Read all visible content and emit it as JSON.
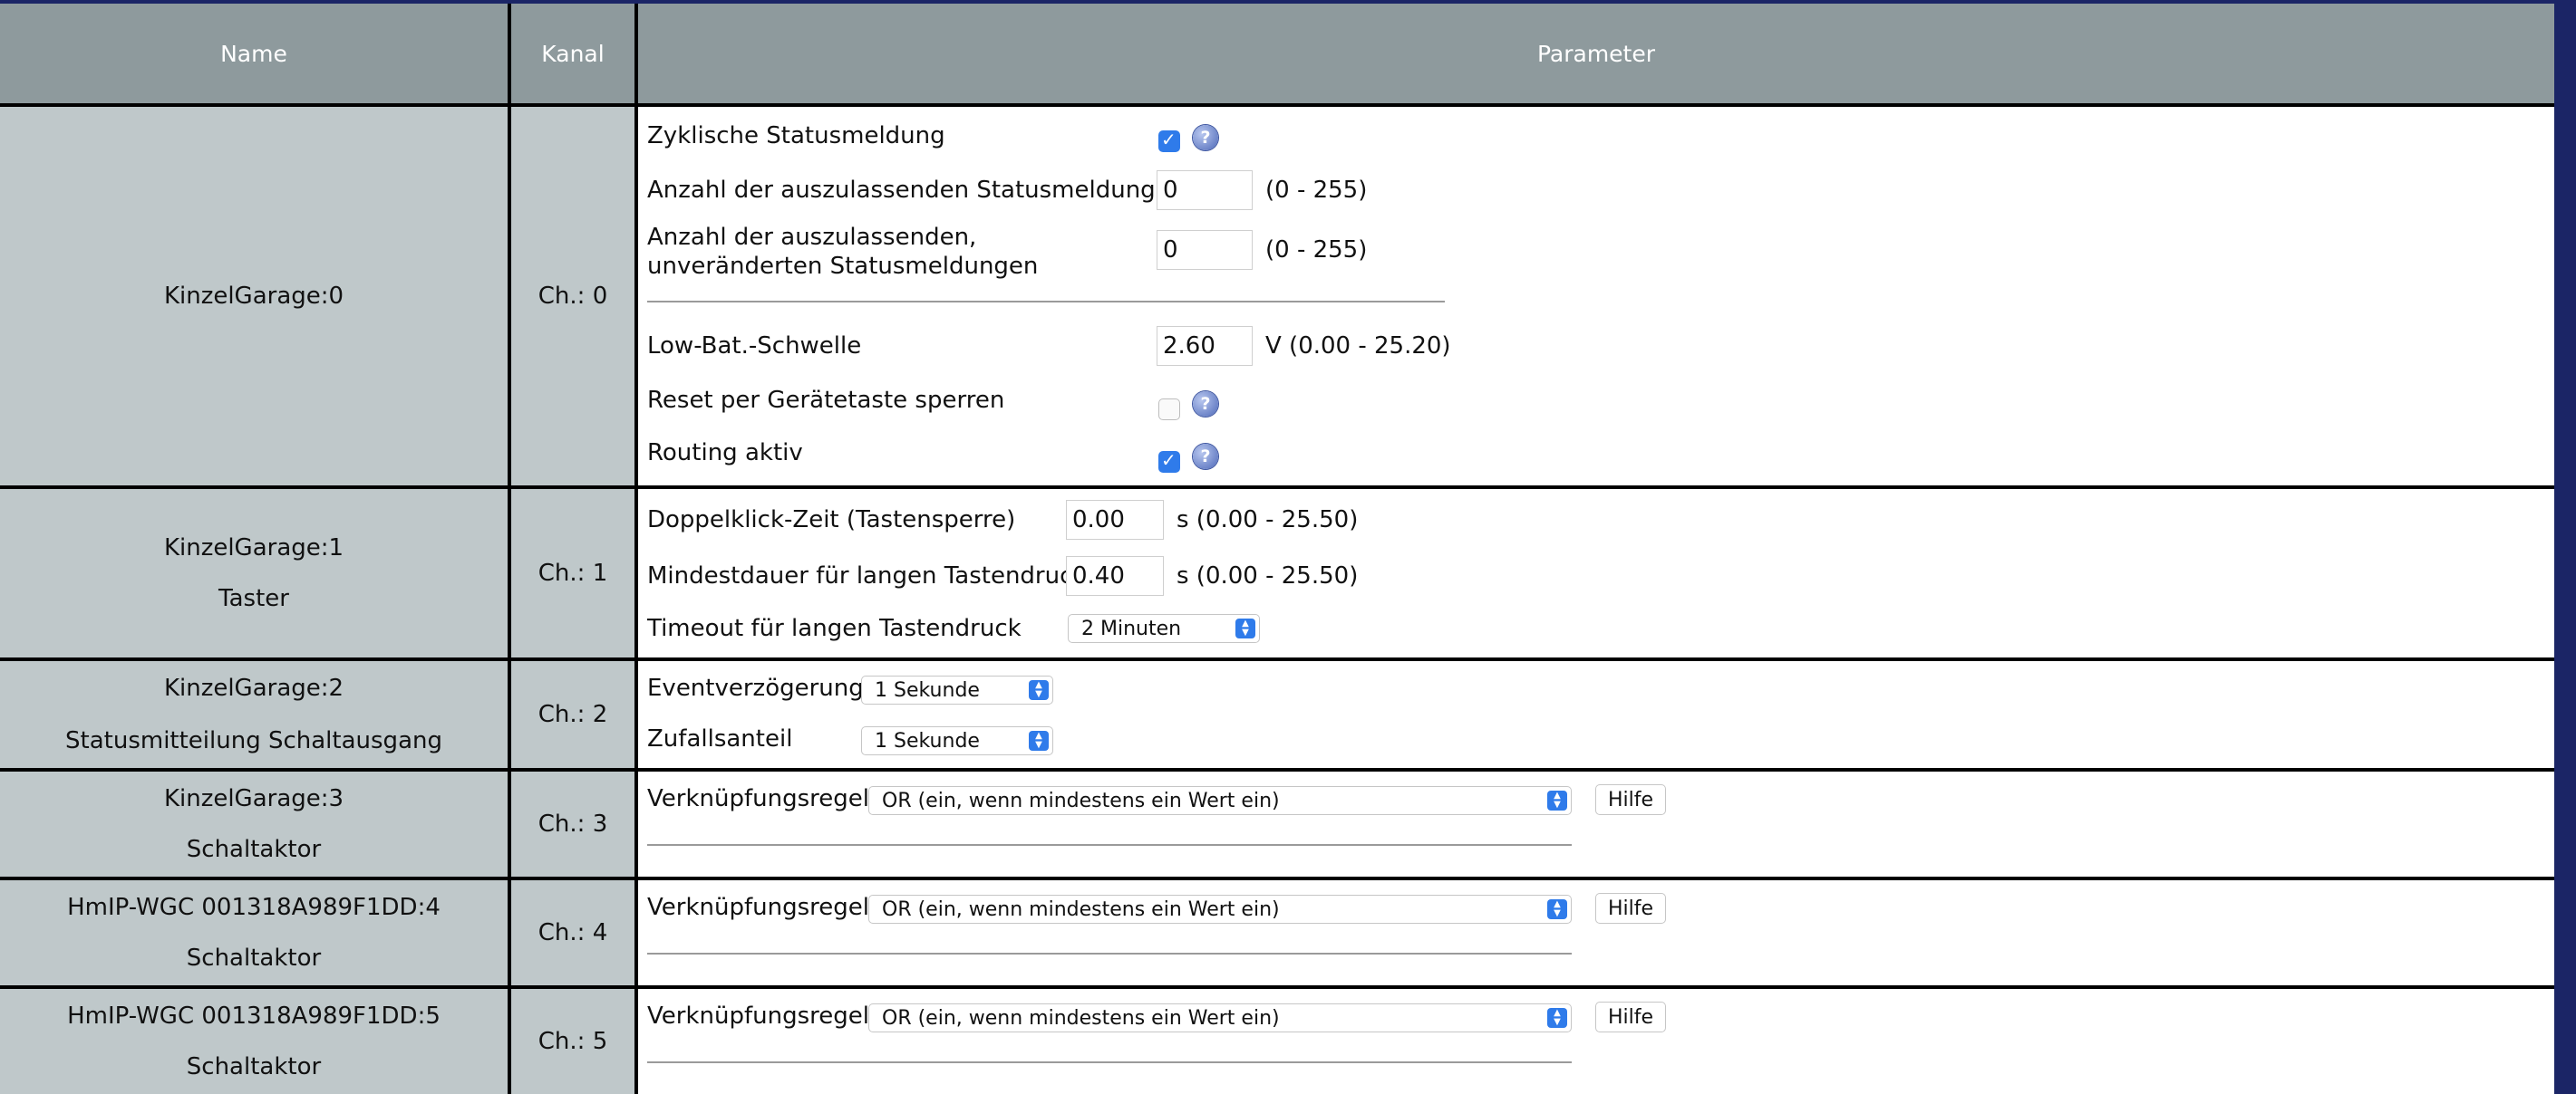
{
  "header": {
    "name": "Name",
    "channel": "Kanal",
    "parameter": "Parameter"
  },
  "rows": [
    {
      "name": "KinzelGarage:0",
      "type": "",
      "channel": "Ch.: 0",
      "params": {
        "cyclic_status": "Zyklische Statusmeldung",
        "skip_status": "Anzahl der auszulassenden Statusmeldungen",
        "skip_status_value": "0",
        "skip_status_range": "(0 - 255)",
        "skip_unchanged": "Anzahl der auszulassenden, unveränderten Statusmeldungen",
        "skip_unchanged_value": "0",
        "skip_unchanged_range": "(0 - 255)",
        "lowbat": "Low-Bat.-Schwelle",
        "lowbat_value": "2.60",
        "lowbat_range": "V (0.00 - 25.20)",
        "reset_lock": "Reset per Gerätetaste sperren",
        "routing": "Routing aktiv"
      }
    },
    {
      "name": "KinzelGarage:1",
      "type": "Taster",
      "channel": "Ch.: 1",
      "params": {
        "doubleclick": "Doppelklick-Zeit (Tastensperre)",
        "doubleclick_value": "0.00",
        "doubleclick_range": "s (0.00 - 25.50)",
        "minlong": "Mindestdauer für langen Tastendruck",
        "minlong_value": "0.40",
        "minlong_range": "s (0.00 - 25.50)",
        "timeout": "Timeout für langen Tastendruck",
        "timeout_value": "2 Minuten"
      }
    },
    {
      "name": "KinzelGarage:2",
      "type": "Statusmitteilung Schaltausgang",
      "channel": "Ch.: 2",
      "params": {
        "event_delay": "Eventverzögerung",
        "event_delay_value": "1 Sekunde",
        "random": "Zufallsanteil",
        "random_value": "1 Sekunde"
      }
    },
    {
      "name": "KinzelGarage:3",
      "type": "Schaltaktor",
      "channel": "Ch.: 3",
      "params": {
        "rule": "Verknüpfungsregel",
        "rule_value": "OR (ein, wenn mindestens ein Wert ein)",
        "help": "Hilfe"
      }
    },
    {
      "name": "HmIP-WGC 001318A989F1DD:4",
      "type": "Schaltaktor",
      "channel": "Ch.: 4",
      "params": {
        "rule": "Verknüpfungsregel",
        "rule_value": "OR (ein, wenn mindestens ein Wert ein)",
        "help": "Hilfe"
      }
    },
    {
      "name": "HmIP-WGC 001318A989F1DD:5",
      "type": "Schaltaktor",
      "channel": "Ch.: 5",
      "params": {
        "rule": "Verknüpfungsregel",
        "rule_value": "OR (ein, wenn mindestens ein Wert ein)",
        "help": "Hilfe"
      }
    }
  ],
  "icons": {
    "help": "help-icon",
    "checkbox": "checkbox",
    "select_arrows": "chevron-updown-icon"
  },
  "colors": {
    "header_bg": "#8e9a9d",
    "cell_bg": "#bfc8ca",
    "accent": "#2f7bea",
    "page_bg": "#1b2566"
  },
  "checked": {
    "cyclic_status": true,
    "reset_lock": false,
    "routing": true
  }
}
